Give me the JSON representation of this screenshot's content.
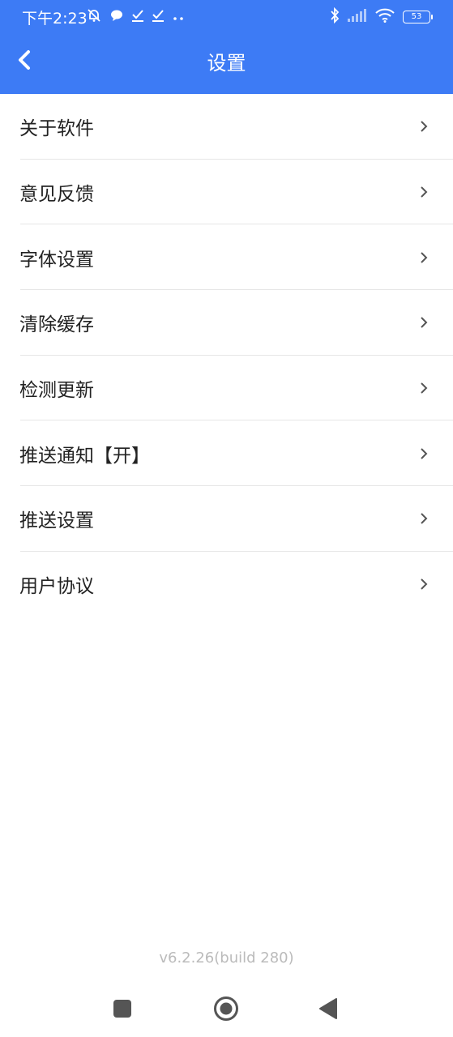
{
  "status_bar": {
    "time": "下午2:23",
    "battery": "53",
    "icons": [
      "mute-bell-icon",
      "chat-bubble-icon",
      "check-download-icon",
      "check-download-icon",
      "more-dots-icon",
      "bluetooth-icon",
      "signal-icon",
      "wifi-icon",
      "battery-icon"
    ]
  },
  "header": {
    "title": "设置",
    "back_icon": "back-chevron-icon",
    "background_color": "#3d7bf5"
  },
  "menu": {
    "items": [
      {
        "label": "关于软件"
      },
      {
        "label": "意见反馈"
      },
      {
        "label": "字体设置"
      },
      {
        "label": "清除缓存"
      },
      {
        "label": "检测更新"
      },
      {
        "label": "推送通知【开】"
      },
      {
        "label": "推送设置"
      },
      {
        "label": "用户协议"
      }
    ],
    "item_icon": "chevron-right-icon"
  },
  "footer": {
    "version": "v6.2.26(build 280)"
  },
  "nav_bar": {
    "buttons": [
      "recent-apps-icon",
      "home-icon",
      "back-triangle-icon"
    ]
  }
}
